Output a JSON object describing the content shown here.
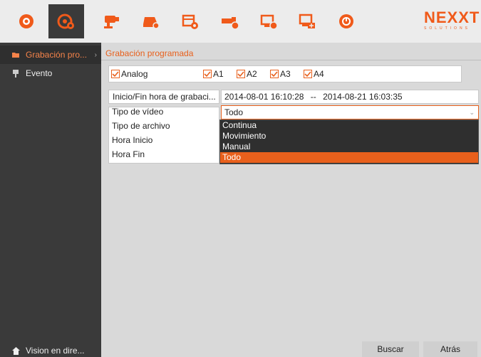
{
  "toolbar": {
    "icons": [
      "live-view-icon",
      "playback-icon",
      "camera-icon",
      "storage-icon",
      "record-icon",
      "network-icon",
      "system-icon",
      "maintenance-icon",
      "shutdown-icon"
    ],
    "active_index": 1,
    "brand": "NEXXT",
    "brand_sub": "SOLUTIONS",
    "accent": "#f05a1a"
  },
  "sidebar": {
    "items": [
      {
        "label": "Grabación pro...",
        "icon": "folder-icon",
        "active": true
      },
      {
        "label": "Evento",
        "icon": "pin-icon",
        "active": false
      }
    ],
    "bottom": {
      "label": "Vision en dire...",
      "icon": "home-icon"
    }
  },
  "main": {
    "title": "Grabación programada",
    "channels": {
      "group": {
        "label": "Analog",
        "checked": true
      },
      "items": [
        {
          "label": "A1",
          "checked": true
        },
        {
          "label": "A2",
          "checked": true
        },
        {
          "label": "A3",
          "checked": true
        },
        {
          "label": "A4",
          "checked": true
        }
      ]
    },
    "time_range": {
      "label": "Inicio/Fin hora de grabaci...",
      "start": "2014-08-01 16:10:28",
      "sep": "--",
      "end": "2014-08-21 16:03:35"
    },
    "video_type": {
      "label": "Tipo de vídeo",
      "value": "Todo",
      "options": [
        "Continua",
        "Movimiento",
        "Manual",
        "Todo"
      ],
      "selected_index": 3
    },
    "file_type": {
      "label": "Tipo de archivo"
    },
    "start_time": {
      "label": "Hora Inicio"
    },
    "end_time": {
      "label": "Hora Fin"
    }
  },
  "buttons": {
    "search": "Buscar",
    "back": "Atrás"
  }
}
